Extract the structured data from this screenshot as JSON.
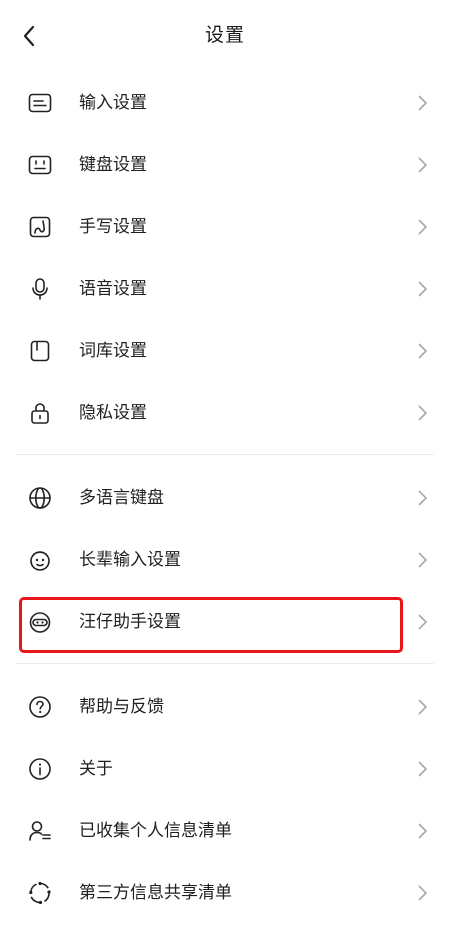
{
  "header": {
    "title": "设置",
    "back_icon": "chevron-left-icon"
  },
  "groups": [
    {
      "items": [
        {
          "label": "输入设置",
          "icon": "keyboard-input-icon"
        },
        {
          "label": "键盘设置",
          "icon": "keyboard-icon"
        },
        {
          "label": "手写设置",
          "icon": "handwriting-icon"
        },
        {
          "label": "语音设置",
          "icon": "microphone-icon"
        },
        {
          "label": "词库设置",
          "icon": "dictionary-icon"
        },
        {
          "label": "隐私设置",
          "icon": "lock-icon"
        }
      ]
    },
    {
      "items": [
        {
          "label": "多语言键盘",
          "icon": "globe-icon"
        },
        {
          "label": "长辈输入设置",
          "icon": "elder-face-icon"
        },
        {
          "label": "汪仔助手设置",
          "icon": "dog-assistant-icon"
        }
      ]
    },
    {
      "items": [
        {
          "label": "帮助与反馈",
          "icon": "help-icon"
        },
        {
          "label": "关于",
          "icon": "info-icon"
        },
        {
          "label": "已收集个人信息清单",
          "icon": "user-list-icon"
        },
        {
          "label": "第三方信息共享清单",
          "icon": "share-circle-icon"
        }
      ]
    }
  ],
  "highlight": {
    "color": "#e8161a",
    "target": "汪仔助手设置"
  }
}
